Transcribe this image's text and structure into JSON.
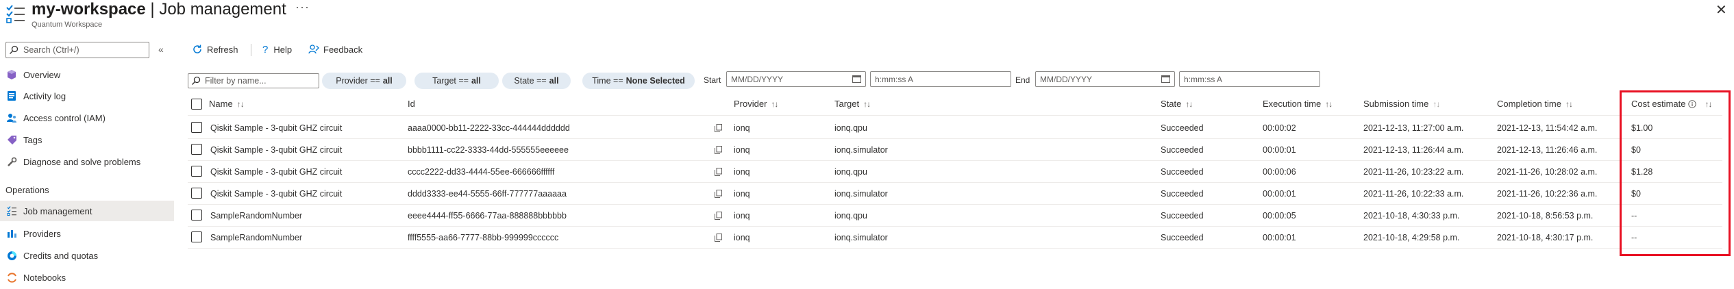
{
  "header": {
    "workspace": "my-workspace",
    "separator": " | ",
    "page": "Job management",
    "subtitle": "Quantum Workspace",
    "more_label": "···",
    "close_label": "✕"
  },
  "sidebar": {
    "search_placeholder": "Search (Ctrl+/)",
    "collapse_label": "«",
    "items": [
      {
        "label": "Overview",
        "icon": "overview-icon"
      },
      {
        "label": "Activity log",
        "icon": "activity-log-icon"
      },
      {
        "label": "Access control (IAM)",
        "icon": "access-control-icon"
      },
      {
        "label": "Tags",
        "icon": "tag-icon"
      },
      {
        "label": "Diagnose and solve problems",
        "icon": "wrench-icon"
      }
    ],
    "section_heading": "Operations",
    "op_items": [
      {
        "label": "Job management",
        "icon": "job-list-icon",
        "selected": true
      },
      {
        "label": "Providers",
        "icon": "providers-icon"
      },
      {
        "label": "Credits and quotas",
        "icon": "credits-icon"
      },
      {
        "label": "Notebooks",
        "icon": "notebook-icon"
      }
    ]
  },
  "toolbar": {
    "refresh": "Refresh",
    "help": "Help",
    "feedback": "Feedback"
  },
  "filters": {
    "name_placeholder": "Filter by name...",
    "provider": {
      "label": "Provider ==",
      "value": "all"
    },
    "target": {
      "label": "Target ==",
      "value": "all"
    },
    "state": {
      "label": "State ==",
      "value": "all"
    },
    "time": {
      "label": "Time ==",
      "value": "None Selected"
    },
    "start_label": "Start",
    "end_label": "End",
    "date_placeholder": "MM/DD/YYYY",
    "time_placeholder": "h:mm:ss A"
  },
  "table": {
    "columns": {
      "name": "Name",
      "id": "Id",
      "provider": "Provider",
      "target": "Target",
      "state": "State",
      "execution_time": "Execution time",
      "submission_time": "Submission time",
      "completion_time": "Completion time",
      "cost_estimate": "Cost estimate"
    },
    "rows": [
      {
        "name": "Qiskit Sample - 3-qubit GHZ circuit",
        "id": "aaaa0000-bb11-2222-33cc-444444dddddd",
        "provider": "ionq",
        "target": "ionq.qpu",
        "state": "Succeeded",
        "execution_time": "00:00:02",
        "submission_time": "2021-12-13, 11:27:00 a.m.",
        "completion_time": "2021-12-13, 11:54:42 a.m.",
        "cost_estimate": "$1.00"
      },
      {
        "name": "Qiskit Sample - 3-qubit GHZ circuit",
        "id": "bbbb1111-cc22-3333-44dd-555555eeeeee",
        "provider": "ionq",
        "target": "ionq.simulator",
        "state": "Succeeded",
        "execution_time": "00:00:01",
        "submission_time": "2021-12-13, 11:26:44 a.m.",
        "completion_time": "2021-12-13, 11:26:46 a.m.",
        "cost_estimate": "$0"
      },
      {
        "name": "Qiskit Sample - 3-qubit GHZ circuit",
        "id": "cccc2222-dd33-4444-55ee-666666ffffff",
        "provider": "ionq",
        "target": "ionq.qpu",
        "state": "Succeeded",
        "execution_time": "00:00:06",
        "submission_time": "2021-11-26, 10:23:22 a.m.",
        "completion_time": "2021-11-26, 10:28:02 a.m.",
        "cost_estimate": "$1.28"
      },
      {
        "name": "Qiskit Sample - 3-qubit GHZ circuit",
        "id": "dddd3333-ee44-5555-66ff-777777aaaaaa",
        "provider": "ionq",
        "target": "ionq.simulator",
        "state": "Succeeded",
        "execution_time": "00:00:01",
        "submission_time": "2021-11-26, 10:22:33 a.m.",
        "completion_time": "2021-11-26, 10:22:36 a.m.",
        "cost_estimate": "$0"
      },
      {
        "name": "SampleRandomNumber",
        "id": "eeee4444-ff55-6666-77aa-888888bbbbbb",
        "provider": "ionq",
        "target": "ionq.qpu",
        "state": "Succeeded",
        "execution_time": "00:00:05",
        "submission_time": "2021-10-18, 4:30:33 p.m.",
        "completion_time": "2021-10-18, 8:56:53 p.m.",
        "cost_estimate": "--"
      },
      {
        "name": "SampleRandomNumber",
        "id": "ffff5555-aa66-7777-88bb-999999cccccc",
        "provider": "ionq",
        "target": "ionq.simulator",
        "state": "Succeeded",
        "execution_time": "00:00:01",
        "submission_time": "2021-10-18, 4:29:58 p.m.",
        "completion_time": "2021-10-18, 4:30:17 p.m.",
        "cost_estimate": "--"
      }
    ]
  },
  "colors": {
    "link": "#0078d4",
    "pill_bg": "#e3ebf3",
    "highlight": "#e81123",
    "selected_bg": "#edebe9"
  }
}
